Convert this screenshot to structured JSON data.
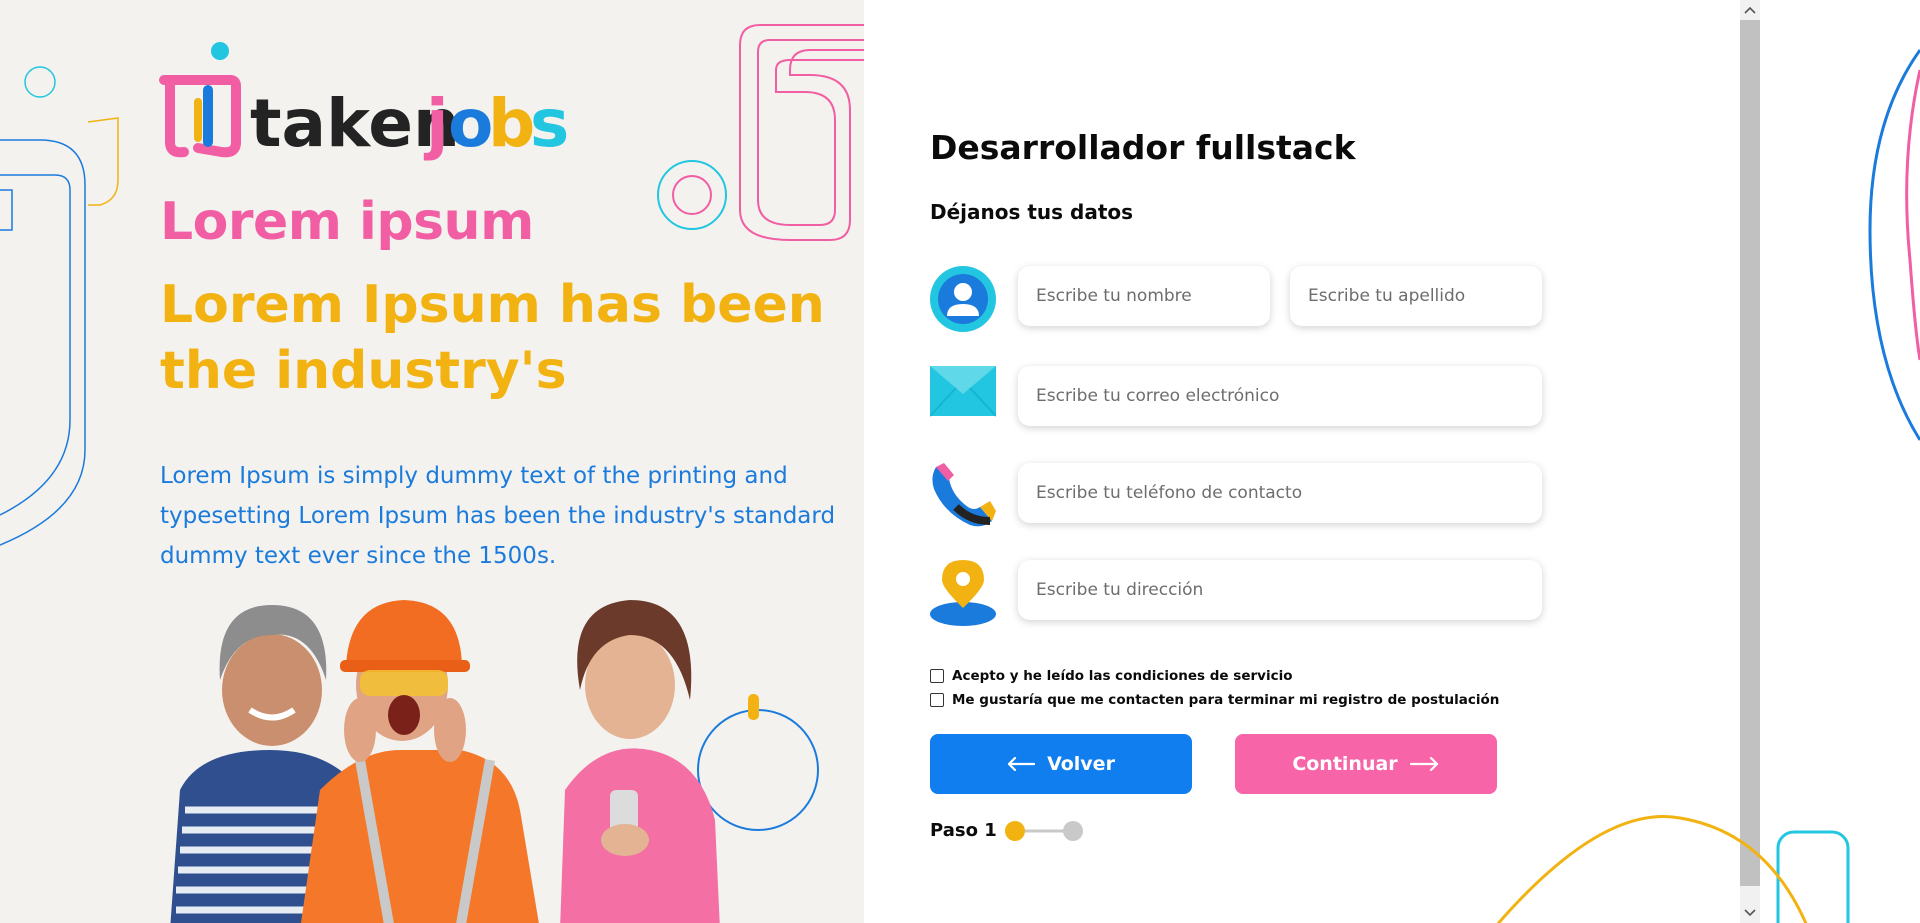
{
  "hero": {
    "logo_text": "takenjobs",
    "heading": "Lorem ipsum",
    "subheading": "Lorem Ipsum has been the industry's",
    "body": "Lorem Ipsum is simply dummy text of the printing and typesetting Lorem Ipsum has been the industry's standard dummy text ever since the 1500s."
  },
  "form": {
    "job_title": "Desarrollador fullstack",
    "subtitle": "Déjanos tus datos",
    "fields": {
      "first_name": {
        "placeholder": "Escribe tu nombre",
        "value": ""
      },
      "last_name": {
        "placeholder": "Escribe tu apellido",
        "value": ""
      },
      "email": {
        "placeholder": "Escribe tu correo electrónico",
        "value": ""
      },
      "phone": {
        "placeholder": "Escribe tu teléfono de contacto",
        "value": ""
      },
      "address": {
        "placeholder": "Escribe tu dirección",
        "value": ""
      }
    },
    "checkboxes": [
      {
        "label": "Acepto y he leído las condiciones de servicio",
        "checked": false
      },
      {
        "label": "Me gustaría que me contacten para terminar mi registro de postulación",
        "checked": false
      }
    ],
    "buttons": {
      "back_label": "Volver",
      "next_label": "Continuar"
    },
    "step": {
      "label": "Paso 1",
      "current": 1,
      "total": 2
    }
  },
  "icons": {
    "user": "user-avatar-icon",
    "email": "envelope-icon",
    "phone": "phone-icon",
    "address": "map-pin-icon",
    "back": "arrow-left-icon",
    "next": "arrow-right-icon"
  },
  "colors": {
    "pink": "#f25ea3",
    "yellow": "#f2b312",
    "blue": "#117ef0",
    "cyan": "#22c6e0",
    "hero_bg": "#f3f2ef",
    "step_active": "#f2b312",
    "step_inactive": "#c9c9c9"
  }
}
